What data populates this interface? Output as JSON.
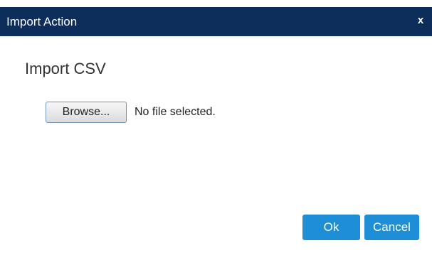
{
  "dialog": {
    "title": "Import Action",
    "close_label": "x",
    "heading": "Import CSV"
  },
  "file_input": {
    "browse_label": "Browse...",
    "status": "No file selected."
  },
  "actions": {
    "ok_label": "Ok",
    "cancel_label": "Cancel"
  },
  "colors": {
    "titlebar": "#0d2e5a",
    "primary_button": "#1e8fd6"
  }
}
